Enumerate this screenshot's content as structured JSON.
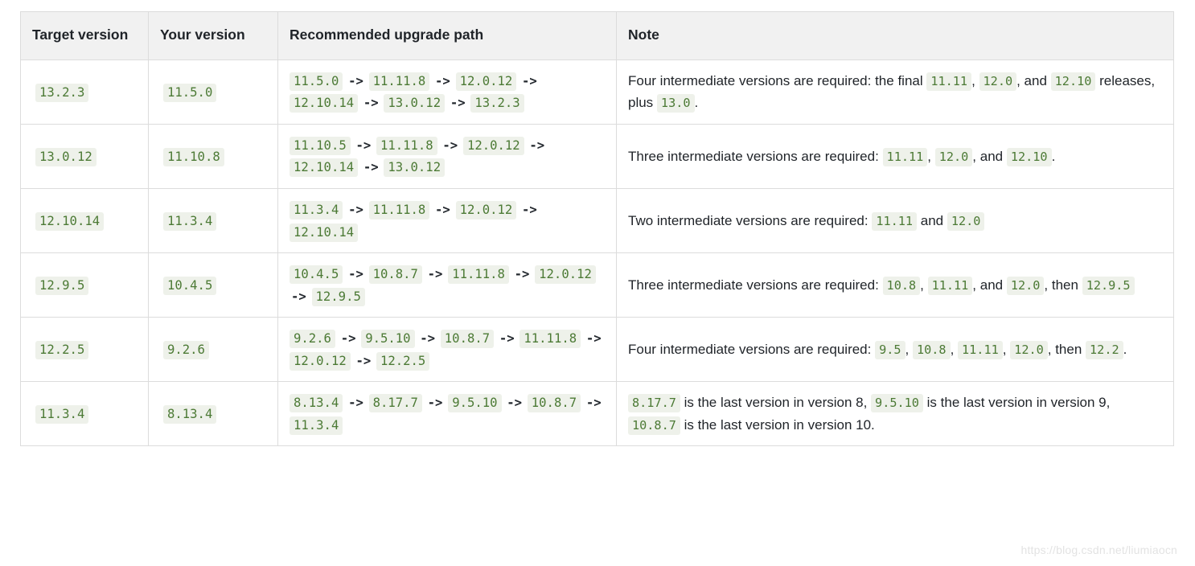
{
  "table": {
    "headers": {
      "target_version": "Target version",
      "your_version": "Your version",
      "upgrade_path": "Recommended upgrade path",
      "note": "Note"
    },
    "arrow": "->",
    "rows": [
      {
        "target_version": "13.2.3",
        "your_version": "11.5.0",
        "path": [
          "11.5.0",
          "11.11.8",
          "12.0.12",
          "12.10.14",
          "13.0.12",
          "13.2.3"
        ],
        "note_parts": [
          {
            "type": "text",
            "value": "Four intermediate versions are required: the final "
          },
          {
            "type": "code",
            "value": "11.11"
          },
          {
            "type": "text",
            "value": ", "
          },
          {
            "type": "code",
            "value": "12.0"
          },
          {
            "type": "text",
            "value": ", and "
          },
          {
            "type": "code",
            "value": "12.10"
          },
          {
            "type": "text",
            "value": " releases, plus "
          },
          {
            "type": "code",
            "value": "13.0"
          },
          {
            "type": "text",
            "value": "."
          }
        ]
      },
      {
        "target_version": "13.0.12",
        "your_version": "11.10.8",
        "path": [
          "11.10.5",
          "11.11.8",
          "12.0.12",
          "12.10.14",
          "13.0.12"
        ],
        "note_parts": [
          {
            "type": "text",
            "value": "Three intermediate versions are required: "
          },
          {
            "type": "code",
            "value": "11.11"
          },
          {
            "type": "text",
            "value": ", "
          },
          {
            "type": "code",
            "value": "12.0"
          },
          {
            "type": "text",
            "value": ", and "
          },
          {
            "type": "code",
            "value": "12.10"
          },
          {
            "type": "text",
            "value": "."
          }
        ]
      },
      {
        "target_version": "12.10.14",
        "your_version": "11.3.4",
        "path": [
          "11.3.4",
          "11.11.8",
          "12.0.12",
          "12.10.14"
        ],
        "note_parts": [
          {
            "type": "text",
            "value": "Two intermediate versions are required: "
          },
          {
            "type": "code",
            "value": "11.11"
          },
          {
            "type": "text",
            "value": " and "
          },
          {
            "type": "code",
            "value": "12.0"
          }
        ]
      },
      {
        "target_version": "12.9.5",
        "your_version": "10.4.5",
        "path": [
          "10.4.5",
          "10.8.7",
          "11.11.8",
          "12.0.12",
          "12.9.5"
        ],
        "note_parts": [
          {
            "type": "text",
            "value": "Three intermediate versions are required: "
          },
          {
            "type": "code",
            "value": "10.8"
          },
          {
            "type": "text",
            "value": ", "
          },
          {
            "type": "code",
            "value": "11.11"
          },
          {
            "type": "text",
            "value": ", and "
          },
          {
            "type": "code",
            "value": "12.0"
          },
          {
            "type": "text",
            "value": ", then "
          },
          {
            "type": "code",
            "value": "12.9.5"
          }
        ]
      },
      {
        "target_version": "12.2.5",
        "your_version": "9.2.6",
        "path": [
          "9.2.6",
          "9.5.10",
          "10.8.7",
          "11.11.8",
          "12.0.12",
          "12.2.5"
        ],
        "note_parts": [
          {
            "type": "text",
            "value": "Four intermediate versions are required: "
          },
          {
            "type": "code",
            "value": "9.5"
          },
          {
            "type": "text",
            "value": ", "
          },
          {
            "type": "code",
            "value": "10.8"
          },
          {
            "type": "text",
            "value": ", "
          },
          {
            "type": "code",
            "value": "11.11"
          },
          {
            "type": "text",
            "value": ", "
          },
          {
            "type": "code",
            "value": "12.0"
          },
          {
            "type": "text",
            "value": ", then "
          },
          {
            "type": "code",
            "value": "12.2"
          },
          {
            "type": "text",
            "value": "."
          }
        ]
      },
      {
        "target_version": "11.3.4",
        "your_version": "8.13.4",
        "path": [
          "8.13.4",
          "8.17.7",
          "9.5.10",
          "10.8.7",
          "11.3.4"
        ],
        "note_parts": [
          {
            "type": "code",
            "value": "8.17.7"
          },
          {
            "type": "text",
            "value": " is the last version in version 8, "
          },
          {
            "type": "code",
            "value": "9.5.10"
          },
          {
            "type": "text",
            "value": " is the last version in version 9, "
          },
          {
            "type": "code",
            "value": "10.8.7"
          },
          {
            "type": "text",
            "value": " is the last version in version 10."
          }
        ]
      }
    ]
  },
  "watermark": "https://blog.csdn.net/liumiaocn",
  "colors": {
    "code_text": "#4c7a35",
    "code_background": "#eef1ea",
    "header_background": "#f1f1f1",
    "border": "#dcdcdc",
    "body_text": "#1f2328"
  }
}
